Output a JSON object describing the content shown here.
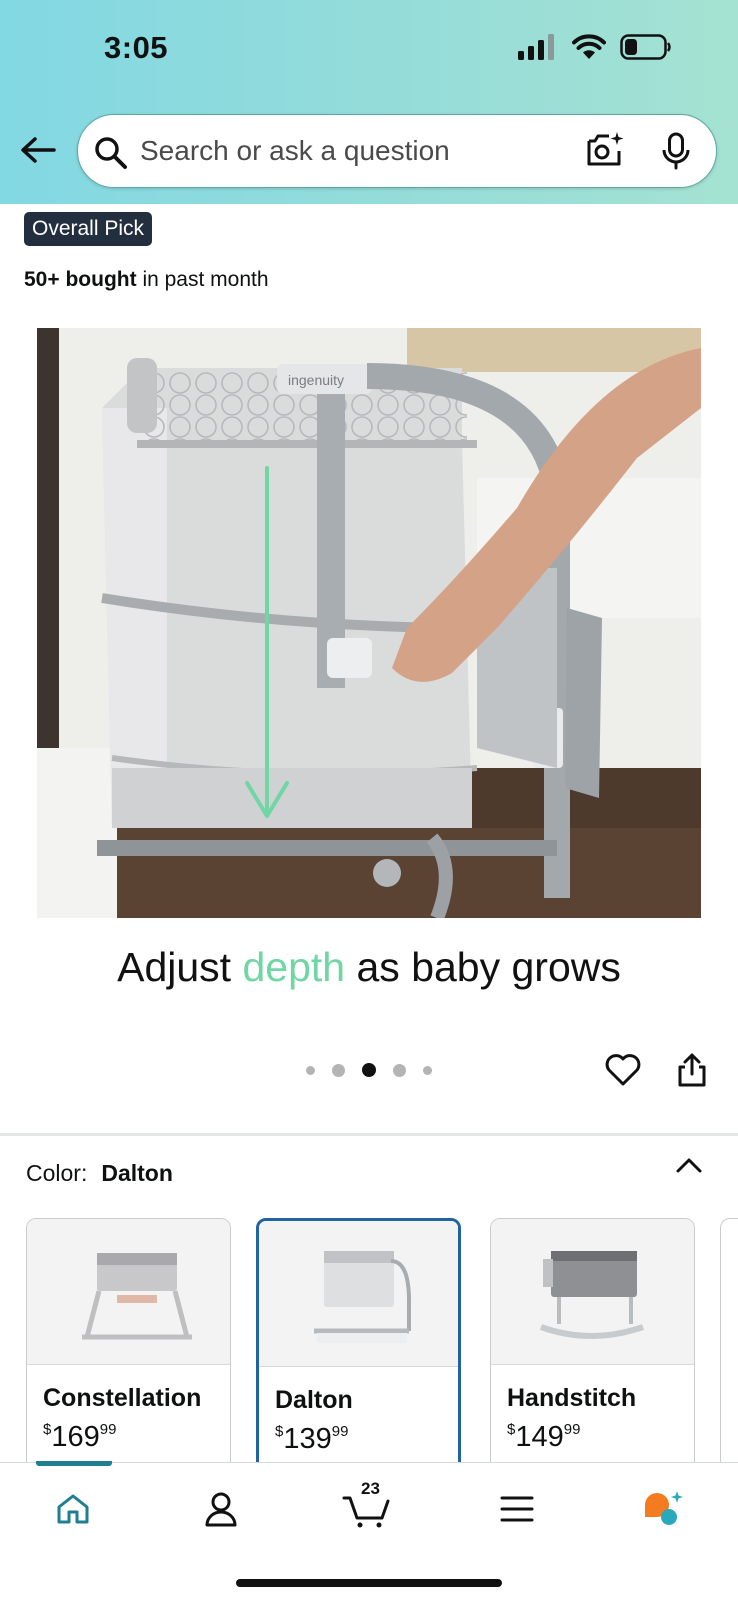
{
  "status_bar": {
    "time": "3:05"
  },
  "search": {
    "placeholder": "Search or ask a question"
  },
  "product": {
    "badge": "Overall Pick",
    "bought_count": "50+ bought",
    "bought_suffix": "in past month",
    "image_brand": "ingenuity",
    "caption_prefix": "Adjust",
    "caption_highlight": "depth",
    "caption_suffix": "as baby grows",
    "carousel": {
      "total": 5,
      "active_index": 2
    }
  },
  "color_selector": {
    "label": "Color:",
    "selected": "Dalton",
    "options": [
      {
        "name": "Constellation",
        "currency": "$",
        "price_whole": "169",
        "price_fraction": "99",
        "selected": false
      },
      {
        "name": "Dalton",
        "currency": "$",
        "price_whole": "139",
        "price_fraction": "99",
        "selected": true
      },
      {
        "name": "Handstitch",
        "currency": "$",
        "price_whole": "149",
        "price_fraction": "99",
        "selected": false
      }
    ]
  },
  "bottom_nav": {
    "cart_count": "23",
    "items": [
      "home-icon",
      "account-icon",
      "cart-icon",
      "menu-icon",
      "rufus-icon"
    ],
    "active": "home-icon"
  },
  "colors": {
    "header_gradient_start": "#82d8e3",
    "header_gradient_end": "#a5e2d2",
    "badge_bg": "#232f3e",
    "caption_highlight": "#6fd6a4",
    "selected_border": "#2162a1",
    "nav_active": "#1f7e8f",
    "rufus_orange": "#f47b20",
    "rufus_teal": "#2aa9bd"
  }
}
